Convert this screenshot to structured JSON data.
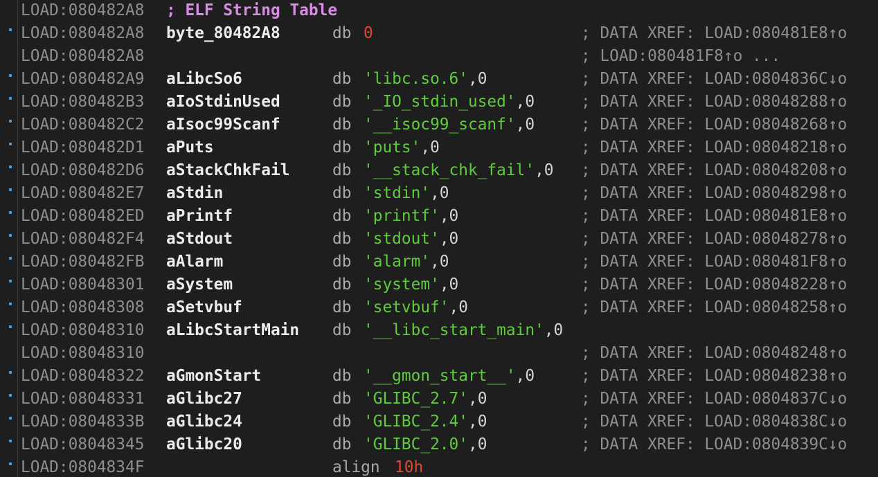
{
  "header": {
    "address": "LOAD:080482A8",
    "comment": "; ELF String Table"
  },
  "rows": [
    {
      "address": "LOAD:080482A8",
      "label": "byte_80482A8",
      "mnemonic": "db",
      "number": "0",
      "comment": "; DATA XREF: LOAD:080481E8↑o"
    },
    {
      "address": "LOAD:080482A8",
      "comment": "; LOAD:080481F8↑o ..."
    },
    {
      "address": "LOAD:080482A9",
      "label": "aLibcSo6",
      "mnemonic": "db",
      "string": "'libc.so.6'",
      "suffix": ",0",
      "comment": "; DATA XREF: LOAD:0804836C↓o"
    },
    {
      "address": "LOAD:080482B3",
      "label": "aIoStdinUsed",
      "mnemonic": "db",
      "string": "'_IO_stdin_used'",
      "suffix": ",0",
      "comment": "; DATA XREF: LOAD:08048288↑o"
    },
    {
      "address": "LOAD:080482C2",
      "label": "aIsoc99Scanf",
      "mnemonic": "db",
      "string": "'__isoc99_scanf'",
      "suffix": ",0",
      "comment": "; DATA XREF: LOAD:08048268↑o"
    },
    {
      "address": "LOAD:080482D1",
      "label": "aPuts",
      "mnemonic": "db",
      "string": "'puts'",
      "suffix": ",0",
      "comment": "; DATA XREF: LOAD:08048218↑o"
    },
    {
      "address": "LOAD:080482D6",
      "label": "aStackChkFail",
      "mnemonic": "db",
      "string": "'__stack_chk_fail'",
      "suffix": ",0",
      "comment": "; DATA XREF: LOAD:08048208↑o"
    },
    {
      "address": "LOAD:080482E7",
      "label": "aStdin",
      "mnemonic": "db",
      "string": "'stdin'",
      "suffix": ",0",
      "comment": "; DATA XREF: LOAD:08048298↑o"
    },
    {
      "address": "LOAD:080482ED",
      "label": "aPrintf",
      "mnemonic": "db",
      "string": "'printf'",
      "suffix": ",0",
      "comment": "; DATA XREF: LOAD:080481E8↑o"
    },
    {
      "address": "LOAD:080482F4",
      "label": "aStdout",
      "mnemonic": "db",
      "string": "'stdout'",
      "suffix": ",0",
      "comment": "; DATA XREF: LOAD:08048278↑o"
    },
    {
      "address": "LOAD:080482FB",
      "label": "aAlarm",
      "mnemonic": "db",
      "string": "'alarm'",
      "suffix": ",0",
      "comment": "; DATA XREF: LOAD:080481F8↑o"
    },
    {
      "address": "LOAD:08048301",
      "label": "aSystem",
      "mnemonic": "db",
      "string": "'system'",
      "suffix": ",0",
      "comment": "; DATA XREF: LOAD:08048228↑o"
    },
    {
      "address": "LOAD:08048308",
      "label": "aSetvbuf",
      "mnemonic": "db",
      "string": "'setvbuf'",
      "suffix": ",0",
      "comment": "; DATA XREF: LOAD:08048258↑o"
    },
    {
      "address": "LOAD:08048310",
      "label": "aLibcStartMain",
      "mnemonic": "db",
      "string": "'__libc_start_main'",
      "suffix": ",0"
    },
    {
      "address": "LOAD:08048310",
      "comment": "; DATA XREF: LOAD:08048248↑o"
    },
    {
      "address": "LOAD:08048322",
      "label": "aGmonStart",
      "mnemonic": "db",
      "string": "'__gmon_start__'",
      "suffix": ",0",
      "comment": "; DATA XREF: LOAD:08048238↑o"
    },
    {
      "address": "LOAD:08048331",
      "label": "aGlibc27",
      "mnemonic": "db",
      "string": "'GLIBC_2.7'",
      "suffix": ",0",
      "comment": "; DATA XREF: LOAD:0804837C↓o"
    },
    {
      "address": "LOAD:0804833B",
      "label": "aGlibc24",
      "mnemonic": "db",
      "string": "'GLIBC_2.4'",
      "suffix": ",0",
      "comment": "; DATA XREF: LOAD:0804838C↓o"
    },
    {
      "address": "LOAD:08048345",
      "label": "aGlibc20",
      "mnemonic": "db",
      "string": "'GLIBC_2.0'",
      "suffix": ",0",
      "comment": "; DATA XREF: LOAD:0804839C↓o"
    },
    {
      "address": "LOAD:0804834F",
      "mnemonic": "align",
      "number": "10h"
    }
  ]
}
